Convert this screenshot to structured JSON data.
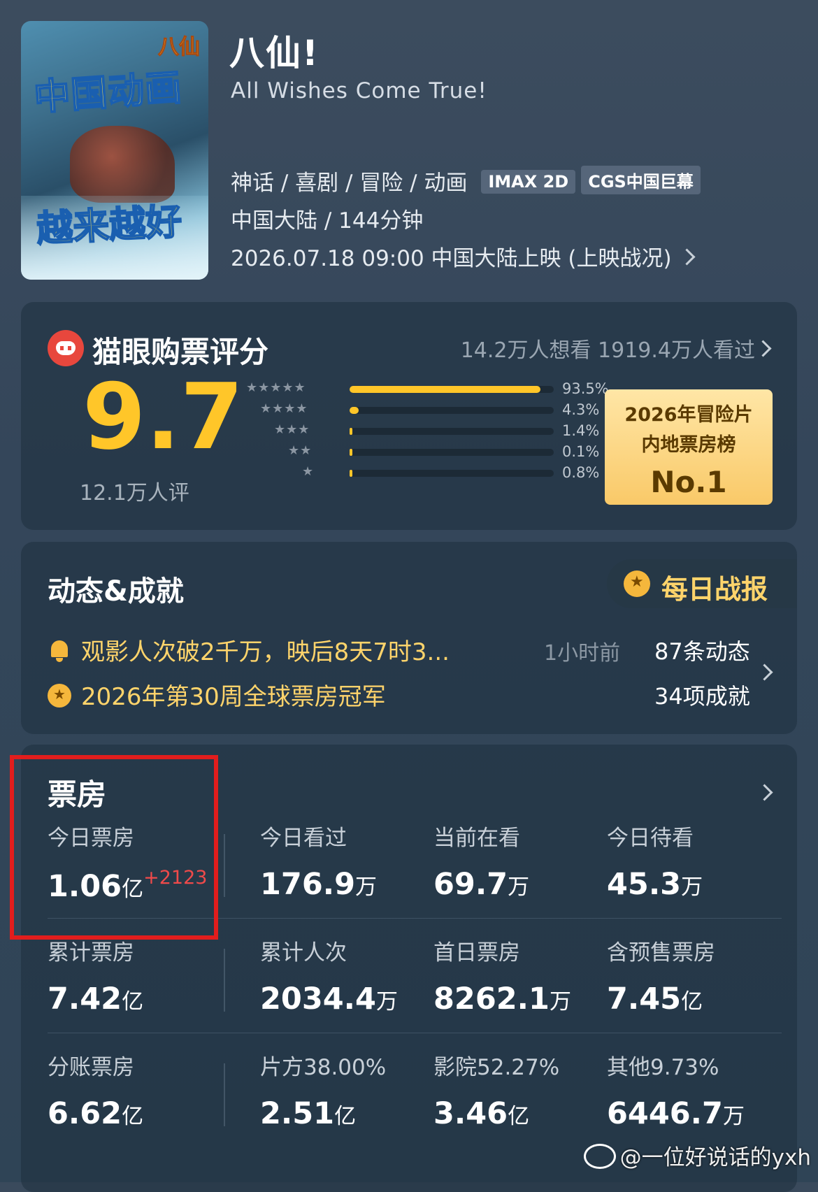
{
  "movie": {
    "title": "八仙!",
    "english_title": "All Wishes Come True!",
    "genres": "神话 / 喜剧 / 冒险 / 动画",
    "tags": [
      "IMAX 2D",
      "CGS中国巨幕"
    ],
    "region_duration": "中国大陆 / 144分钟",
    "release": "2026.07.18 09:00 中国大陆上映 (上映战况)",
    "poster": {
      "logo": "八仙",
      "title": "中国动画",
      "slogan": "越来越好"
    }
  },
  "rating": {
    "title": "猫眼购票评分",
    "want_seen": "14.2万人想看 1919.4万人看过",
    "score": "9.7",
    "count": "12.1万人评",
    "distribution": [
      {
        "stars": "★★★★★",
        "pct_label": "93.5%",
        "pct": 93.5
      },
      {
        "stars": "★★★★",
        "pct_label": "4.3%",
        "pct": 4.3
      },
      {
        "stars": "★★★",
        "pct_label": "1.4%",
        "pct": 1.4
      },
      {
        "stars": "★★",
        "pct_label": "0.1%",
        "pct": 0.1
      },
      {
        "stars": "★",
        "pct_label": "0.8%",
        "pct": 0.8
      }
    ],
    "badge": {
      "line1": "2026年冒险片",
      "line2": "内地票房榜",
      "rank": "No.1"
    }
  },
  "dynamics": {
    "title": "动态&成就",
    "daily_report": "每日战报",
    "items": [
      {
        "text": "观影人次破2千万，映后8天7时3...",
        "time": "1小时前"
      },
      {
        "text": "2026年第30周全球票房冠军"
      }
    ],
    "counts": [
      "87条动态",
      "34项成就"
    ]
  },
  "box_office": {
    "title": "票房",
    "rows": [
      [
        {
          "label": "今日票房",
          "value": "1.06",
          "unit": "亿",
          "delta": "+2123"
        },
        {
          "label": "今日看过",
          "value": "176.9",
          "unit": "万"
        },
        {
          "label": "当前在看",
          "value": "69.7",
          "unit": "万"
        },
        {
          "label": "今日待看",
          "value": "45.3",
          "unit": "万"
        }
      ],
      [
        {
          "label": "累计票房",
          "value": "7.42",
          "unit": "亿"
        },
        {
          "label": "累计人次",
          "value": "2034.4",
          "unit": "万"
        },
        {
          "label": "首日票房",
          "value": "8262.1",
          "unit": "万"
        },
        {
          "label": "含预售票房",
          "value": "7.45",
          "unit": "亿"
        }
      ],
      [
        {
          "label": "分账票房",
          "value": "6.62",
          "unit": "亿"
        },
        {
          "label": "片方38.00%",
          "value": "2.51",
          "unit": "亿"
        },
        {
          "label": "影院52.27%",
          "value": "3.46",
          "unit": "亿"
        },
        {
          "label": "其他9.73%",
          "value": "6446.7",
          "unit": "万"
        }
      ]
    ]
  },
  "watermark": "@一位好说话的yxh",
  "colors": {
    "accent": "#ffc629",
    "highlight_box": "#e21d1d",
    "delta": "#f04a4a",
    "achievement": "#ffd46b"
  }
}
